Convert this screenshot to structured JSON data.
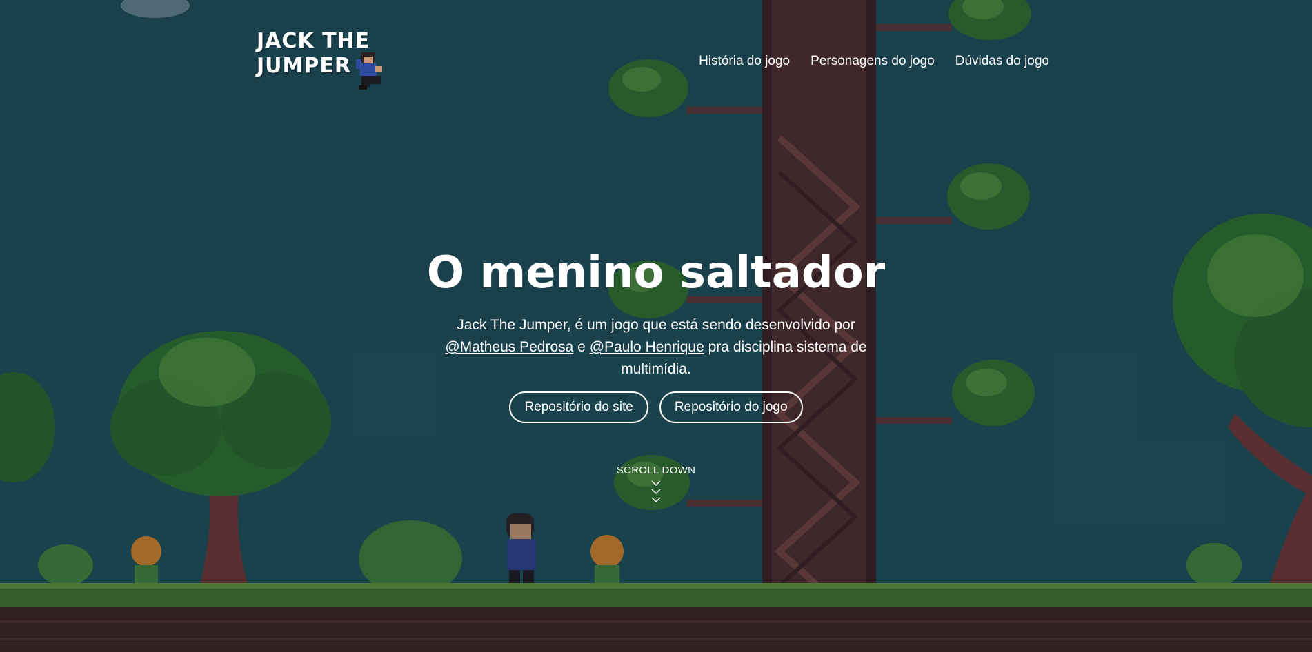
{
  "header": {
    "logo_line1": "JACK THE",
    "logo_line2": "JUMPER",
    "nav": [
      {
        "label": "História do jogo"
      },
      {
        "label": "Personagens do jogo"
      },
      {
        "label": "Dúvidas do jogo"
      }
    ]
  },
  "hero": {
    "title": "O menino saltador",
    "desc_part1": "Jack The Jumper, é um jogo que está sendo desenvolvido por ",
    "author1": "@Matheus Pedrosa",
    "desc_part2": " e ",
    "author2": "@Paulo Henrique",
    "desc_part3": " pra disciplina sistema de multimídia.",
    "buttons": [
      {
        "label": "Repositório do site"
      },
      {
        "label": "Repositório do jogo"
      }
    ]
  },
  "scroll": {
    "label": "SCROLL DOWN"
  },
  "icons": {
    "logo_sprite": "jumping-boy-icon",
    "scroll": "chevron-down-icon"
  },
  "colors": {
    "sky": "#1d4a55",
    "tree_trunk": "#4a2c2a",
    "foliage": "#2f6a2c",
    "grass": "#3b6b2a",
    "dirt": "#3a2322",
    "text": "#ffffff"
  }
}
